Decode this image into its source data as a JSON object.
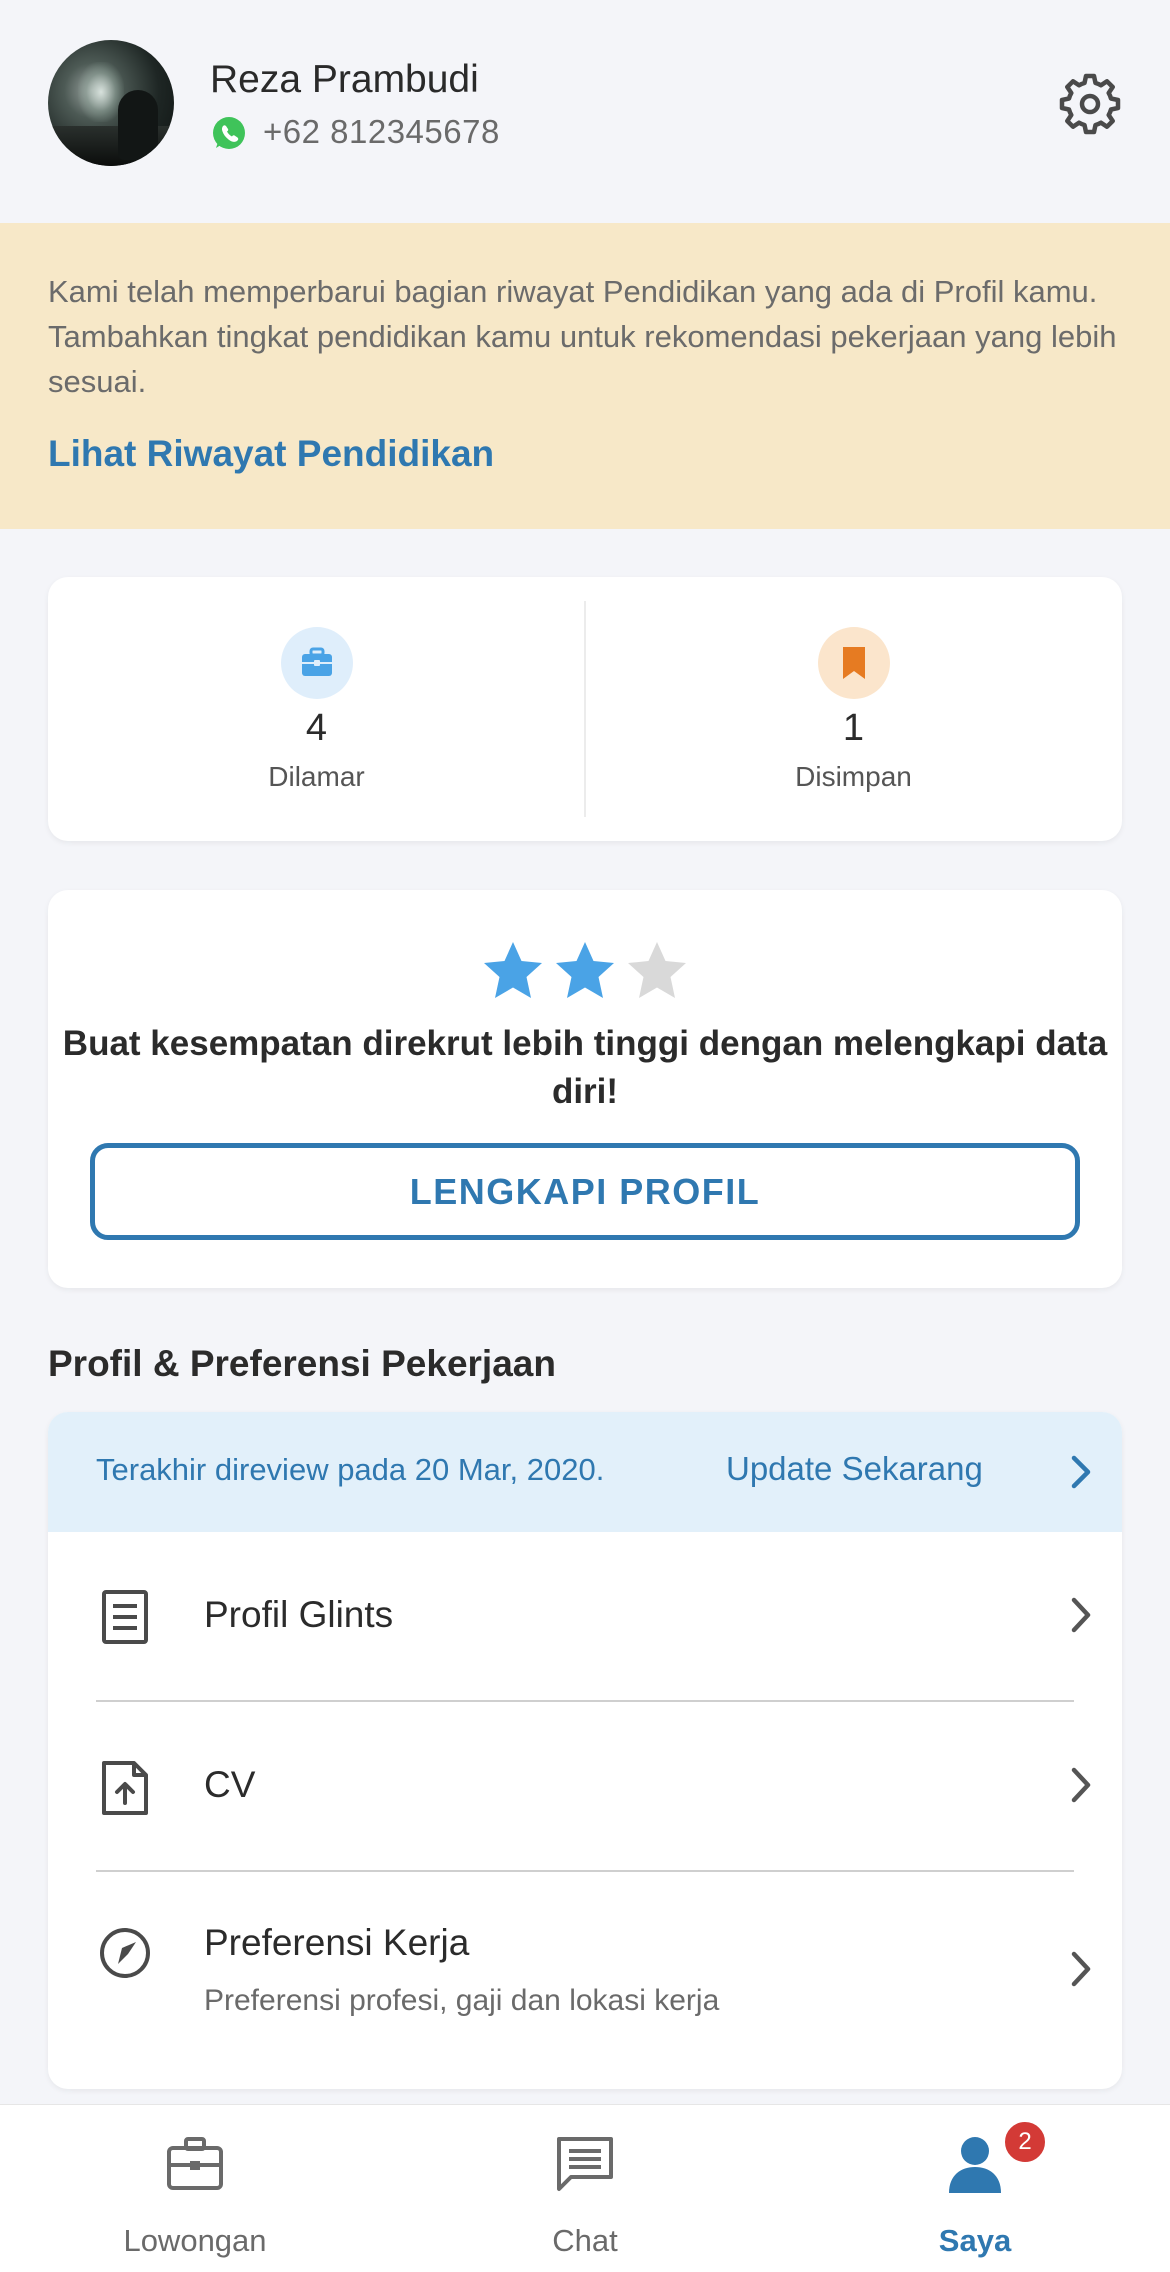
{
  "profile": {
    "name": "Reza Prambudi",
    "phone": "+62 812345678"
  },
  "banner": {
    "message": "Kami telah memperbarui bagian riwayat Pendidikan yang ada di Profil kamu. Tambahkan tingkat pendidikan kamu untuk rekomendasi pekerjaan yang lebih sesuai.",
    "link": "Lihat Riwayat Pendidikan"
  },
  "stats": [
    {
      "icon": "briefcase-icon",
      "value": "4",
      "label": "Dilamar"
    },
    {
      "icon": "bookmark-icon",
      "value": "1",
      "label": "Disimpan"
    }
  ],
  "promo": {
    "rating": 2,
    "rating_max": 3,
    "text": "Buat kesempatan direkrut lebih tinggi dengan melengkapi data diri!",
    "button": "LENGKAPI PROFIL"
  },
  "section": {
    "title": "Profil & Preferensi Pekerjaan",
    "review_text": "Terakhir direview pada 20 Mar, 2020.",
    "update_link": "Update Sekarang",
    "items": [
      {
        "label": "Profil Glints",
        "sub": "",
        "icon": "document-icon"
      },
      {
        "label": "CV",
        "sub": "",
        "icon": "file-upload-icon"
      },
      {
        "label": "Preferensi Kerja",
        "sub": "Preferensi profesi, gaji dan lokasi kerja",
        "icon": "compass-icon"
      }
    ]
  },
  "nav": {
    "items": [
      {
        "label": "Lowongan",
        "icon": "briefcase-icon"
      },
      {
        "label": "Chat",
        "icon": "chat-icon"
      },
      {
        "label": "Saya",
        "icon": "user-icon",
        "badge": "2",
        "active": true
      }
    ]
  },
  "colors": {
    "accent": "#2f78b0",
    "banner_bg": "#f7e8c8",
    "star_active": "#4aa3e6",
    "star_inactive": "#d9d9d9",
    "badge": "#d33a36"
  }
}
